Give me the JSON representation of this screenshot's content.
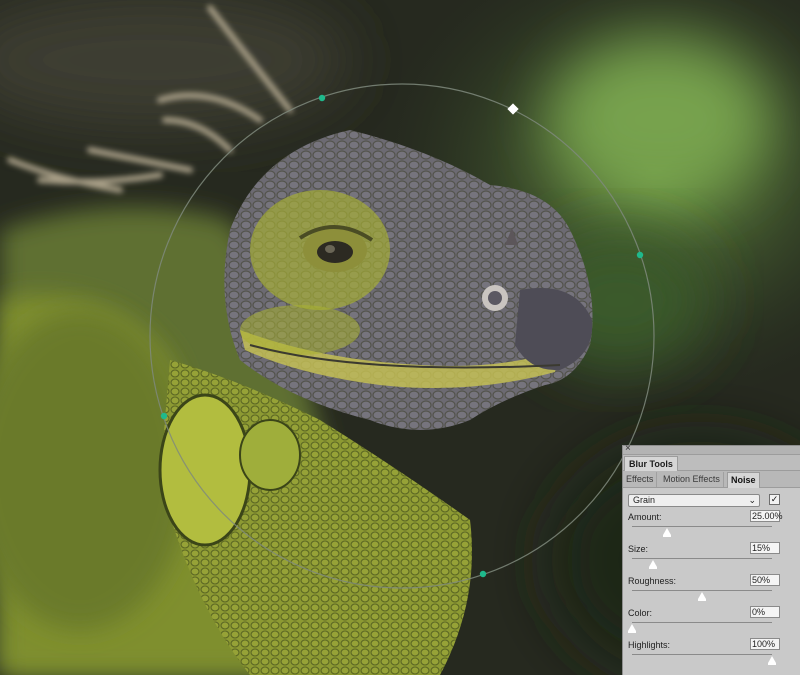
{
  "scene": {
    "subject": "iguana-photo",
    "blur_ring": {
      "handle_color": "#1fb98c",
      "ring_color": "#7f8a7c"
    }
  },
  "panel": {
    "close_glyph": "×",
    "title": "Blur Tools",
    "tabs": [
      {
        "label": "Effects",
        "active": false
      },
      {
        "label": "Motion Effects",
        "active": false
      },
      {
        "label": "Noise",
        "active": true
      }
    ],
    "dropdown": {
      "value": "Grain",
      "chevron": "⌄"
    },
    "checkbox": {
      "checked": true,
      "glyph": "✓"
    },
    "params": [
      {
        "label": "Amount:",
        "value": "25.00%",
        "fraction": 0.25
      },
      {
        "label": "Size:",
        "value": "15%",
        "fraction": 0.15
      },
      {
        "label": "Roughness:",
        "value": "50%",
        "fraction": 0.5
      },
      {
        "label": "Color:",
        "value": "0%",
        "fraction": 0.0
      },
      {
        "label": "Highlights:",
        "value": "100%",
        "fraction": 1.0
      }
    ]
  }
}
